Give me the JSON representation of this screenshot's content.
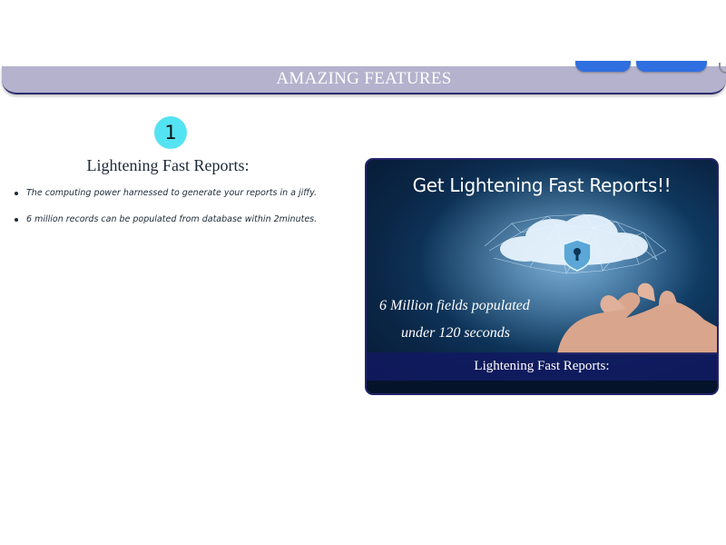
{
  "header": {
    "title": "AMAZING FEATURES"
  },
  "feature": {
    "step_number": "1",
    "heading": "Lightening Fast Reports:",
    "bullets": [
      "The computing power harnessed to generate your reports in a jiffy.",
      "6 million records can be populated from database within 2minutes."
    ]
  },
  "promo": {
    "title": "Get Lightening Fast Reports!!",
    "line1": "6 Million fields populated",
    "line2": "under 120 seconds",
    "caption": "Lightening Fast Reports:"
  },
  "colors": {
    "banner": "#b4b2cd",
    "badge": "#54e3f2",
    "nav_button": "#2f6fe0",
    "caption_bar": "#101960"
  }
}
